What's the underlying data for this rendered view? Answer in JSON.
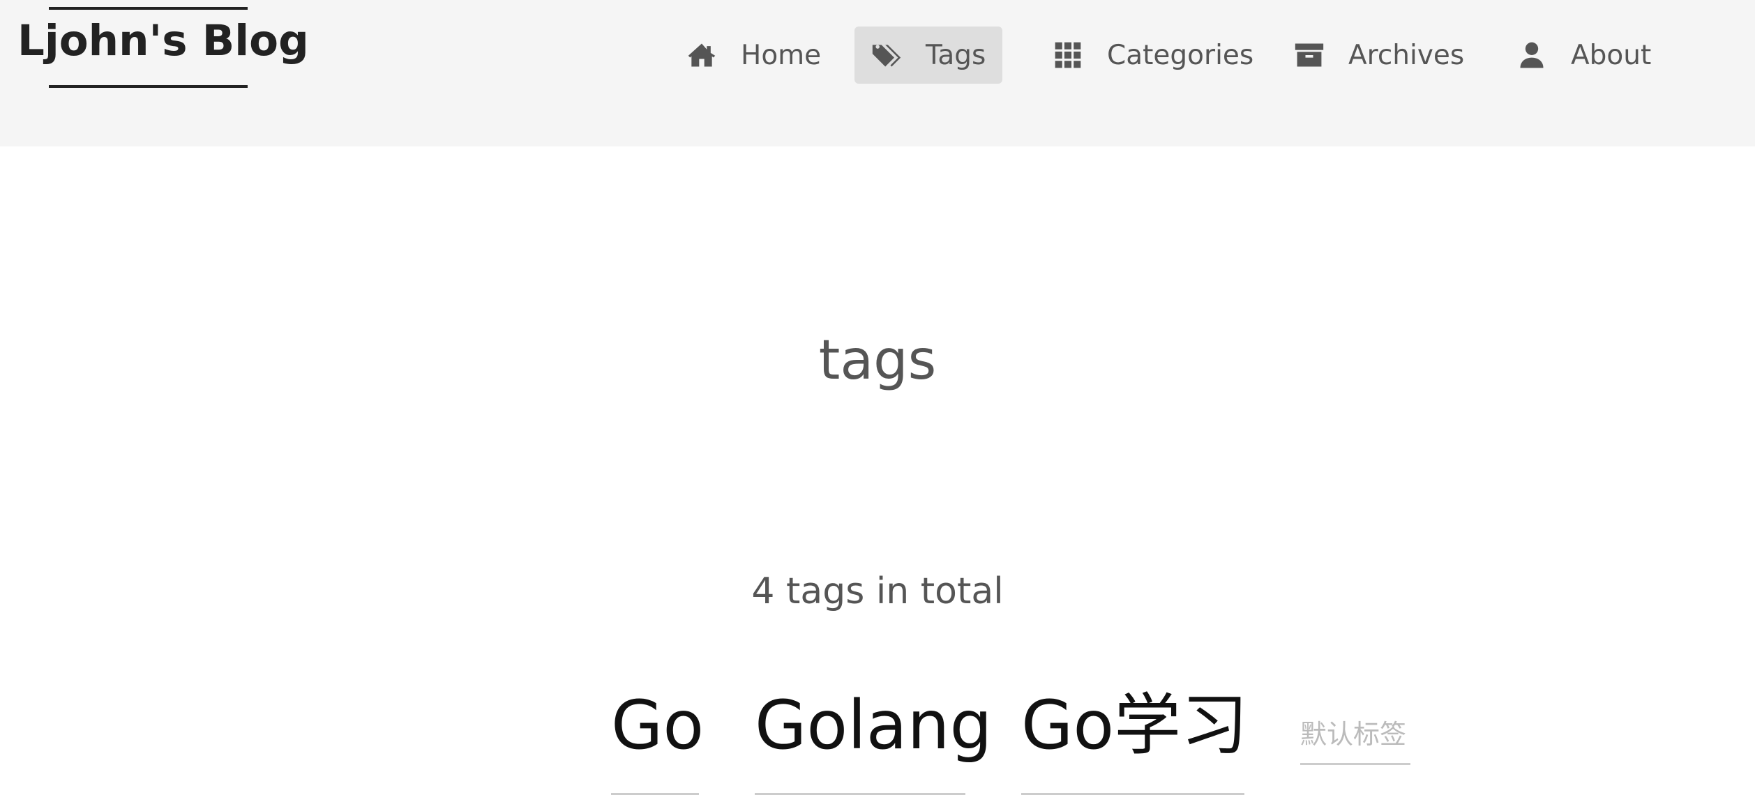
{
  "site": {
    "title": "Ljohn's Blog"
  },
  "nav": {
    "items": [
      {
        "label": "Home",
        "icon": "home-icon"
      },
      {
        "label": "Tags",
        "icon": "tags-icon",
        "active": true
      },
      {
        "label": "Categories",
        "icon": "grid-icon"
      },
      {
        "label": "Archives",
        "icon": "archive-icon"
      },
      {
        "label": "About",
        "icon": "user-icon"
      }
    ]
  },
  "page": {
    "title": "tags",
    "count_text": "4 tags in total"
  },
  "tags": [
    {
      "label": "Go"
    },
    {
      "label": "Golang"
    },
    {
      "label": "Go学习"
    },
    {
      "label": "默认标签"
    }
  ],
  "colors": {
    "header_bg": "#f5f5f5",
    "active_nav_bg": "#dedede",
    "text_muted": "#555555",
    "tag_dark": "#111111",
    "tag_light": "#bbbbbb"
  }
}
